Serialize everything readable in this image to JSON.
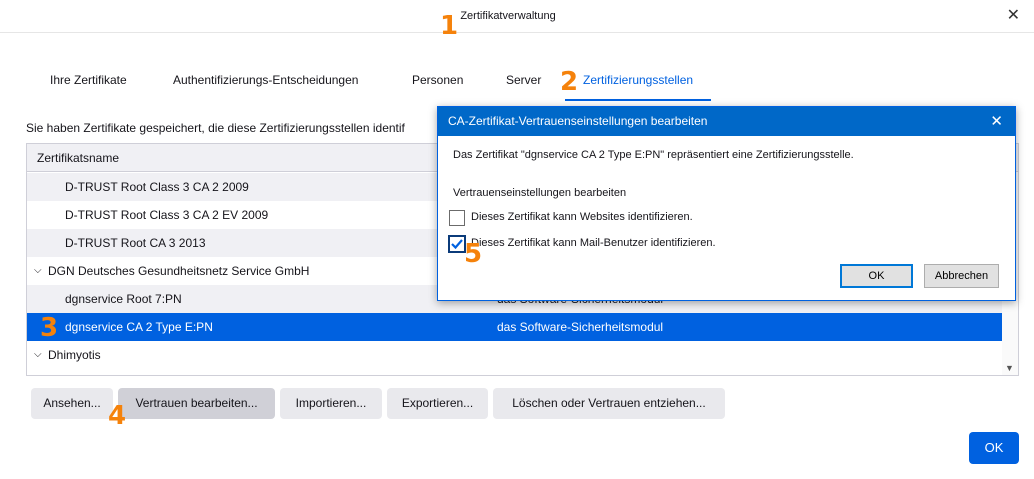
{
  "window": {
    "title": "Zertifikatverwaltung",
    "close_glyph": "✕"
  },
  "tabs": [
    {
      "label": "Ihre Zertifikate",
      "selected": false
    },
    {
      "label": "Authentifizierungs-Entscheidungen",
      "selected": false
    },
    {
      "label": "Personen",
      "selected": false
    },
    {
      "label": "Server",
      "selected": false
    },
    {
      "label": "Zertifizierungsstellen",
      "selected": true
    }
  ],
  "intro_text": "Sie haben Zertifikate gespeichert, die diese Zertifizierungsstellen identif",
  "tree": {
    "column_header": "Zertifikatsname",
    "rows": [
      {
        "name": "D-TRUST Root Class 3 CA 2 2009",
        "device": "",
        "group": false
      },
      {
        "name": "D-TRUST Root Class 3 CA 2 EV 2009",
        "device": "",
        "group": false
      },
      {
        "name": "D-TRUST Root CA 3 2013",
        "device": "",
        "group": false
      },
      {
        "name": "DGN Deutsches Gesundheitsnetz Service GmbH",
        "device": "",
        "group": true
      },
      {
        "name": "dgnservice Root 7:PN",
        "device": "das Software-Sicherheitsmodul",
        "group": false
      },
      {
        "name": "dgnservice CA 2 Type E:PN",
        "device": "das Software-Sicherheitsmodul",
        "group": false,
        "selected": true
      },
      {
        "name": "Dhimyotis",
        "device": "",
        "group": true
      }
    ]
  },
  "buttons": {
    "view": "Ansehen...",
    "edit_trust": "Vertrauen bearbeiten...",
    "import": "Importieren...",
    "export": "Exportieren...",
    "delete": "Löschen oder Vertrauen entziehen...",
    "ok": "OK"
  },
  "dialog": {
    "title": "CA-Zertifikat-Vertrauenseinstellungen bearbeiten",
    "close_glyph": "✕",
    "message": "Das Zertifikat \"dgnservice CA 2 Type E:PN\" repräsentiert eine Zertifizierungsstelle.",
    "section": "Vertrauenseinstellungen bearbeiten",
    "websites_label": "Dieses Zertifikat kann Websites identifizieren.",
    "websites_checked": false,
    "mail_label": "Dieses Zertifikat kann Mail-Benutzer identifizieren.",
    "mail_checked": true,
    "ok": "OK",
    "cancel": "Abbrechen"
  },
  "markers": [
    "1",
    "2",
    "3",
    "4",
    "5"
  ],
  "colors": {
    "accent": "#0061e0",
    "dialog_title": "#0068c8",
    "marker": "#f5820b"
  }
}
